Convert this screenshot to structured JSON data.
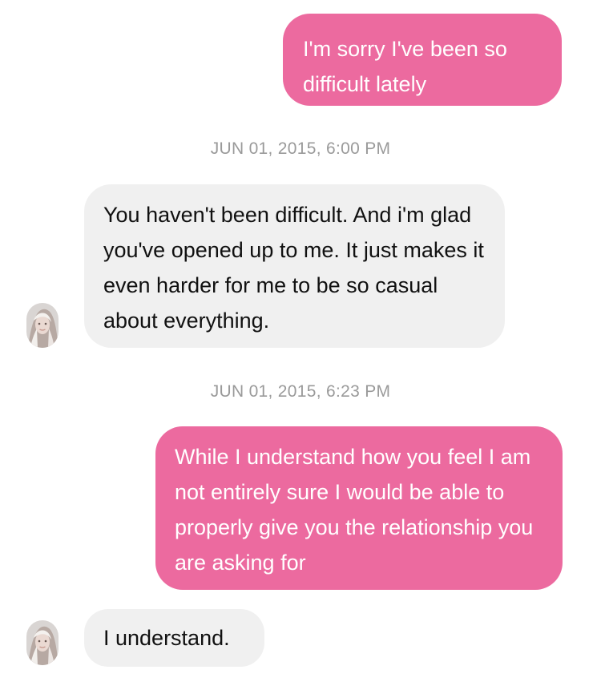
{
  "conversation": {
    "messages": [
      {
        "sender": "me",
        "text": "I'm sorry I've been so difficult lately"
      },
      {
        "sender": "them",
        "text": "You haven't been difficult. And i'm glad you've opened up to me. It just makes it even harder for me to be so casual about everything."
      },
      {
        "sender": "me",
        "text": "While I understand how you feel I am not entirely sure I would be able to properly give you the relationship you are asking for"
      },
      {
        "sender": "them",
        "text": "I understand."
      }
    ],
    "timestamps": [
      "JUN 01, 2015, 6:00 PM",
      "JUN 01, 2015, 6:23 PM"
    ]
  },
  "colors": {
    "sent_bubble": "#ec6a9f",
    "received_bubble": "#f0f0f0",
    "timestamp_text": "#9a9a9a"
  },
  "icons": {
    "avatar": "contact-avatar"
  }
}
